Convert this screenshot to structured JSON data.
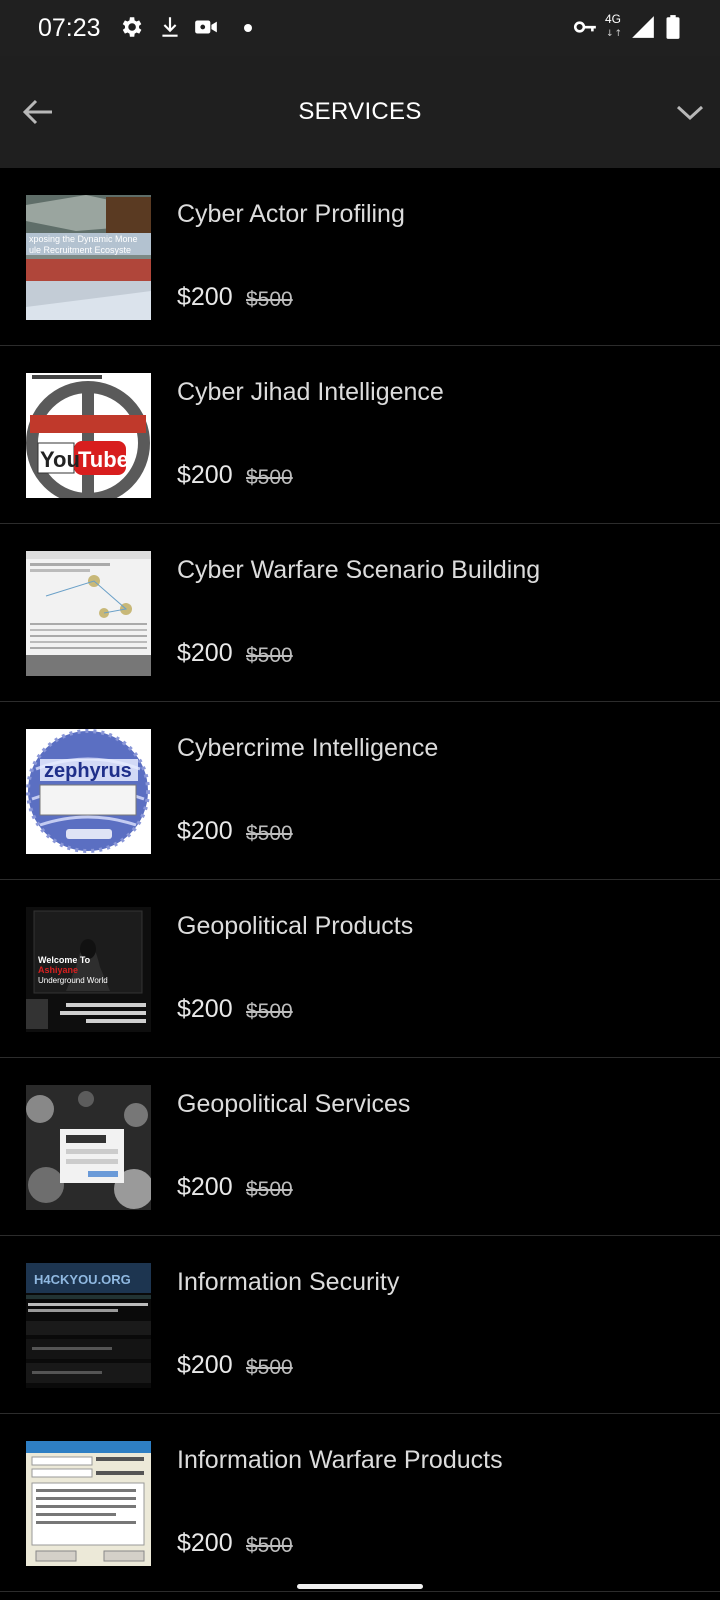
{
  "status_bar": {
    "time": "07:23",
    "icons": [
      "settings-icon",
      "download-icon",
      "video-camera-icon",
      "notification-dot",
      "vpn-key-icon",
      "signal-icon",
      "battery-icon"
    ],
    "network": "4G"
  },
  "app_bar": {
    "title": "SERVICES",
    "back_icon": "arrow-left-icon",
    "menu_icon": "chevron-down-icon"
  },
  "services": [
    {
      "name": "Cyber Actor Profiling",
      "price": "$200",
      "old_price": "$500"
    },
    {
      "name": "Cyber Jihad Intelligence",
      "price": "$200",
      "old_price": "$500"
    },
    {
      "name": "Cyber Warfare Scenario Building",
      "price": "$200",
      "old_price": "$500"
    },
    {
      "name": "Cybercrime Intelligence",
      "price": "$200",
      "old_price": "$500"
    },
    {
      "name": "Geopolitical Products",
      "price": "$200",
      "old_price": "$500"
    },
    {
      "name": "Geopolitical Services",
      "price": "$200",
      "old_price": "$500"
    },
    {
      "name": "Information Security",
      "price": "$200",
      "old_price": "$500"
    },
    {
      "name": "Information Warfare Products",
      "price": "$200",
      "old_price": "$500"
    }
  ],
  "thumbnails": [
    {
      "text": "xposing the Dynamic Mone / ule Recruitment Ecosyste"
    },
    {
      "text": "YouTube"
    },
    {
      "text": ""
    },
    {
      "text": "zephyrus"
    },
    {
      "text": "Welcome To / Ashiyane / Underground World"
    },
    {
      "text": ""
    },
    {
      "text": "H4CKYOU.ORG"
    },
    {
      "text": ""
    }
  ],
  "colors": {
    "background": "#000000",
    "appbar": "#1f1f1f",
    "statusbar": "#202020",
    "divider": "#2c2c2c",
    "text": "#dcdcdc"
  }
}
